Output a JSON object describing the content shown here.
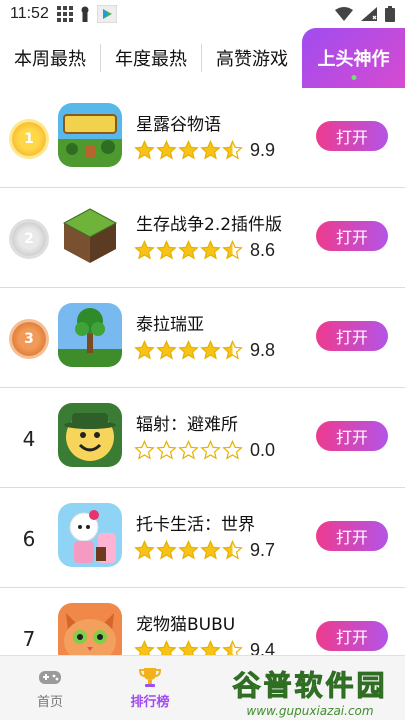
{
  "status_bar": {
    "time": "11:52"
  },
  "tabs": [
    {
      "label": "本周最热",
      "active": false
    },
    {
      "label": "年度最热",
      "active": false
    },
    {
      "label": "高赞游戏",
      "active": false
    },
    {
      "label": "上头神作",
      "active": true
    }
  ],
  "list": [
    {
      "rank": "1",
      "medal": "gold",
      "name": "星露谷物语",
      "rating": "9.9",
      "stars": 4.5,
      "button": "打开",
      "icon": "stardew-valley-icon"
    },
    {
      "rank": "2",
      "medal": "silver",
      "name": "生存战争2.2插件版",
      "rating": "8.6",
      "stars": 4.5,
      "button": "打开",
      "icon": "survivalcraft-icon"
    },
    {
      "rank": "3",
      "medal": "bronze",
      "name": "泰拉瑞亚",
      "rating": "9.8",
      "stars": 4.5,
      "button": "打开",
      "icon": "terraria-icon"
    },
    {
      "rank": "4",
      "medal": "",
      "name": "辐射：避难所",
      "rating": "0.0",
      "stars": 0,
      "button": "打开",
      "icon": "fallout-shelter-icon"
    },
    {
      "rank": "6",
      "medal": "",
      "name": "托卡生活：世界",
      "rating": "9.7",
      "stars": 4.5,
      "button": "打开",
      "icon": "toca-life-icon"
    },
    {
      "rank": "7",
      "medal": "",
      "name": "宠物猫BUBU",
      "rating": "9.4",
      "stars": 4.5,
      "button": "打开",
      "icon": "bubu-cat-icon"
    }
  ],
  "bottom_nav": [
    {
      "label": "首页",
      "icon": "gamepad-icon",
      "active": false
    },
    {
      "label": "排行榜",
      "icon": "trophy-icon",
      "active": true
    }
  ],
  "watermark": {
    "title": "谷普软件园",
    "url": "www.gupuxiazai.com"
  }
}
